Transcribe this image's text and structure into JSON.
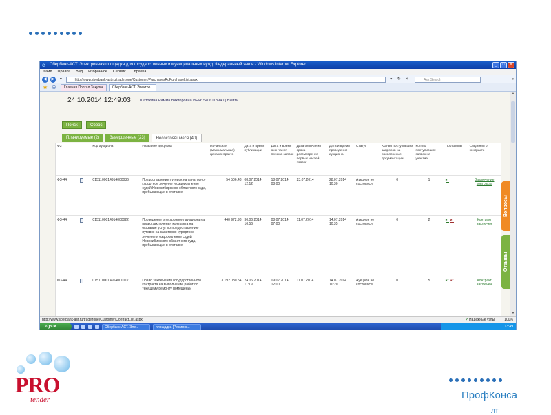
{
  "window": {
    "title": "Сбербанк-АСТ. Электронная площадка для государственных и муниципальных нужд. Федеральный закон - Windows Internet Explorer",
    "menu": [
      "Файл",
      "Правка",
      "Вид",
      "Избранное",
      "Сервис",
      "Справка"
    ],
    "address": "http://www.sberbank-ast.ru/tradezone/Customer/PurchasesRuPurchaseList.aspx",
    "search_placeholder": "Ask Search",
    "tabs": [
      "Главная Портал Закупок",
      "Сбербанк-АСТ. Электро..."
    ]
  },
  "page": {
    "datetime": "24.10.2014 12:49:03",
    "user": "Шатохина Римма Викторовна ИНН: 5406118940 | Выйти",
    "search_button": "Поиск",
    "reset_button": "Сброс",
    "filter_tabs": [
      "Планируемые (2)",
      "Завершенные (23)",
      "Несостоявшиеся (40)"
    ]
  },
  "table": {
    "headers": [
      "ФЗ",
      "",
      "Код аукциона",
      "Название аукциона",
      "Начальная (максимальная) цена контракта",
      "Дата и время публикации",
      "Дата и время окончания приема заявок",
      "Дата окончания срока рассмотрения первых частей заявок",
      "Дата и время проведения аукциона",
      "Статус",
      "Кол-во поступивших запросов на разъяснение документации",
      "Кол-во поступивших заявок на участие",
      "Протоколы",
      "Сведения о контракте"
    ],
    "rows": [
      {
        "fz": "ФЗ-44",
        "code": "0151100014914000036",
        "name": "Предоставление путевок на санаторно-курортное лечение и оздоровление судей Новосибирского областного суда, пребывающих в отставке",
        "price": "54 506.48",
        "published": "08.07.2014 12:12",
        "end_accept": "18.07.2014 08:00",
        "end_review": "23.07.2014",
        "auction_date": "28.07.2014 10:30",
        "status": "Аукцион не состоялся",
        "requests": "0",
        "applications": "1",
        "protocols": [
          "ит"
        ],
        "contract": "Заключение контракта"
      },
      {
        "fz": "ФЗ-44",
        "code": "0151100014914000022",
        "name": "Проведение электронного аукциона на право заключения контракта на оказание услуг по предоставлению путевок на санаторно-курортное лечение и оздоровление судей Новосибирского областного суда, пребывающих в отставке",
        "price": "440 972.98",
        "published": "30.06.2014 10:56",
        "end_accept": "08.07.2014 07:00",
        "end_review": "11.07.2014",
        "auction_date": "14.07.2014 10:35",
        "status": "Аукцион не состоялся",
        "requests": "0",
        "applications": "2",
        "protocols": [
          "ит",
          "ит"
        ],
        "contract": "Контракт заключен"
      },
      {
        "fz": "ФЗ-44",
        "code": "0151100014914000017",
        "name": "Право заключения государственного контракта на выполнение работ по текущему ремонту помещений",
        "price": "3 192 080.54",
        "published": "24.06.2014 11:19",
        "end_accept": "09.07.2014 12:00",
        "end_review": "11.07.2014",
        "auction_date": "14.07.2014 10:20",
        "status": "Аукцион не состоялся",
        "requests": "0",
        "applications": "5",
        "protocols": [
          "ит",
          "ит"
        ],
        "contract": "Контракт заключен"
      }
    ]
  },
  "side_tabs": [
    "Вопросы",
    "Отзывы"
  ],
  "statusbar": {
    "url": "http://www.sberbank-ast.ru/tradezone/Customer/ContractList.aspx",
    "zone": "Надежные узлы",
    "zoom": "100%"
  },
  "taskbar": {
    "start": "пуск",
    "tasks": [
      "Сбербанк-АСТ. Эле...",
      "площадка [Режим с..."
    ],
    "tray": "13:49"
  },
  "branding": {
    "logo_main": "PRO",
    "logo_sub": "tender",
    "company_line1": "ПрофКонса",
    "company_line2": "лт"
  },
  "colors": {
    "accent_green": "#7cb342",
    "accent_orange": "#f08a24",
    "brand_red": "#c8102e",
    "brand_blue": "#2a7fc1"
  }
}
